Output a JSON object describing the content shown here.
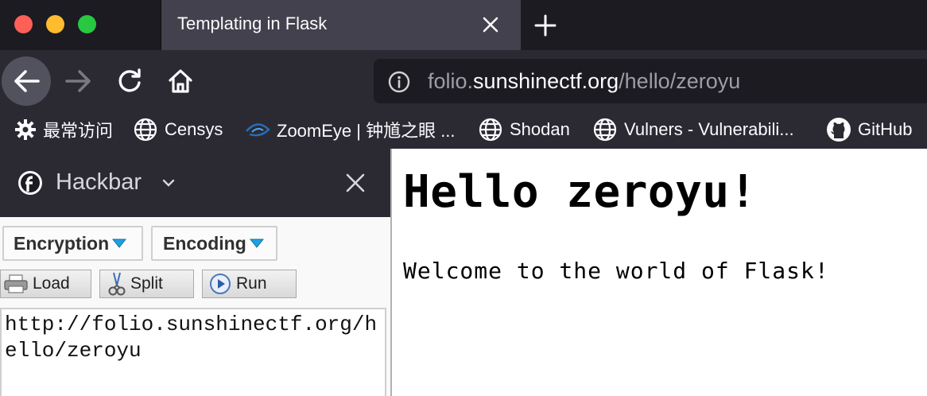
{
  "tab": {
    "title": "Templating in Flask"
  },
  "url": {
    "prefix": "folio.",
    "domain": "sunshinectf.org",
    "path": "/hello/zeroyu"
  },
  "bookmarks": [
    {
      "label": "最常访问",
      "icon": "gear-icon"
    },
    {
      "label": "Censys",
      "icon": "globe-icon"
    },
    {
      "label": "ZoomEye | 钟馗之眼 ...",
      "icon": "zoomeye-icon"
    },
    {
      "label": "Shodan",
      "icon": "globe-icon"
    },
    {
      "label": "Vulners - Vulnerabili...",
      "icon": "globe-icon"
    },
    {
      "label": "GitHub",
      "icon": "github-icon"
    }
  ],
  "sidebar": {
    "title": "Hackbar",
    "menus": {
      "encryption": "Encryption",
      "encoding": "Encoding"
    },
    "buttons": {
      "load": "Load",
      "split": "Split",
      "run": "Run"
    },
    "textarea": "http://folio.sunshinectf.org/hello/zeroyu"
  },
  "page": {
    "heading": "Hello zeroyu!",
    "paragraph": "Welcome to the world of Flask!"
  },
  "colors": {
    "accent_blue": "#0a84ff",
    "menu_arrow": "#1ea1e0"
  }
}
